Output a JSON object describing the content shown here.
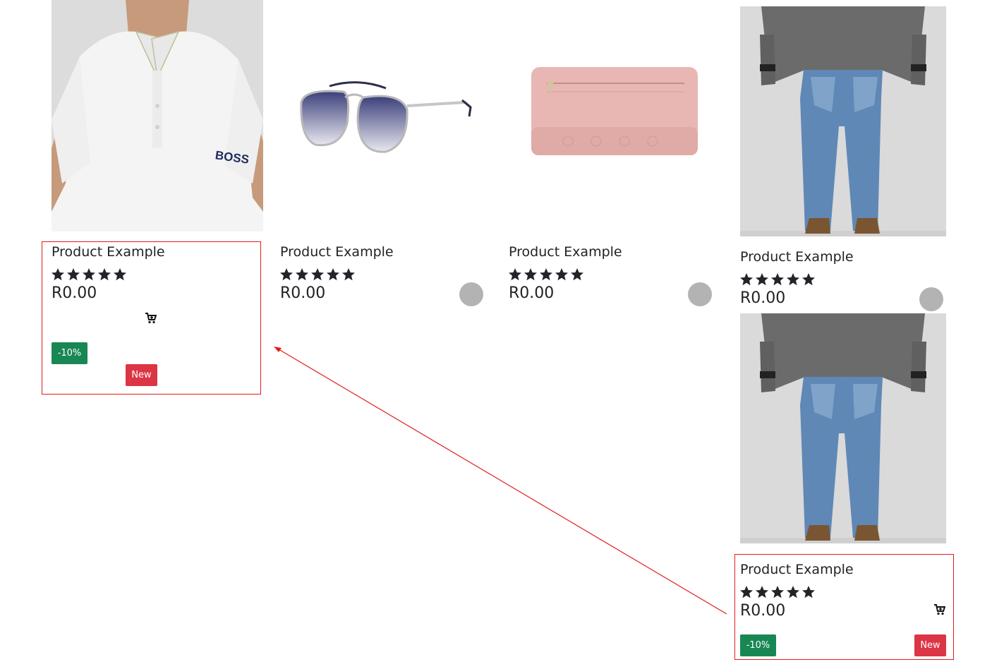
{
  "products": [
    {
      "name": "polo-shirt",
      "title": "Product Example",
      "rating": 5,
      "price": "R0.00"
    },
    {
      "name": "sunglasses",
      "title": "Product Example",
      "rating": 5,
      "price": "R0.00"
    },
    {
      "name": "wallet",
      "title": "Product Example",
      "rating": 5,
      "price": "R0.00"
    },
    {
      "name": "jeans",
      "title": "Product Example",
      "rating": 5,
      "price": "R0.00"
    },
    {
      "name": "jeans-highlighted",
      "title": "Product Example",
      "rating": 5,
      "price": "R0.00"
    }
  ],
  "badges": {
    "discount": "-10%",
    "new": "New"
  },
  "colors": {
    "discount_badge": "#198754",
    "new_badge": "#dc3545",
    "annotation": "#e31b1b",
    "cart_button": "#b3b3b3"
  }
}
